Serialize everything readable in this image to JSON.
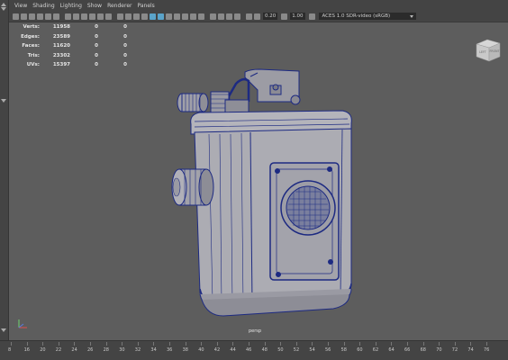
{
  "menu": [
    "View",
    "Shading",
    "Lighting",
    "Show",
    "Renderer",
    "Panels"
  ],
  "toolbar": {
    "exposure": "0.20",
    "gamma": "1.00",
    "colorspace": "ACES 1.0 SDR-video (sRGB)"
  },
  "hud": [
    {
      "label": "Verts:",
      "value": "11958",
      "sel": "0",
      "comp": "0"
    },
    {
      "label": "Edges:",
      "value": "23589",
      "sel": "0",
      "comp": "0"
    },
    {
      "label": "Faces:",
      "value": "11620",
      "sel": "0",
      "comp": "0"
    },
    {
      "label": "Tris:",
      "value": "23302",
      "sel": "0",
      "comp": "0"
    },
    {
      "label": "UVs:",
      "value": "15397",
      "sel": "0",
      "comp": "0"
    }
  ],
  "viewcube": {
    "left": "LEFT",
    "front": "FRONT"
  },
  "camera": "persp",
  "timeline": {
    "ticks": [
      "8",
      "16",
      "20",
      "22",
      "24",
      "26",
      "28",
      "30",
      "32",
      "34",
      "36",
      "38",
      "40",
      "42",
      "44",
      "46",
      "48",
      "50",
      "52",
      "54",
      "56",
      "58",
      "60",
      "62",
      "64",
      "66",
      "68",
      "70",
      "72",
      "74",
      "76"
    ]
  }
}
